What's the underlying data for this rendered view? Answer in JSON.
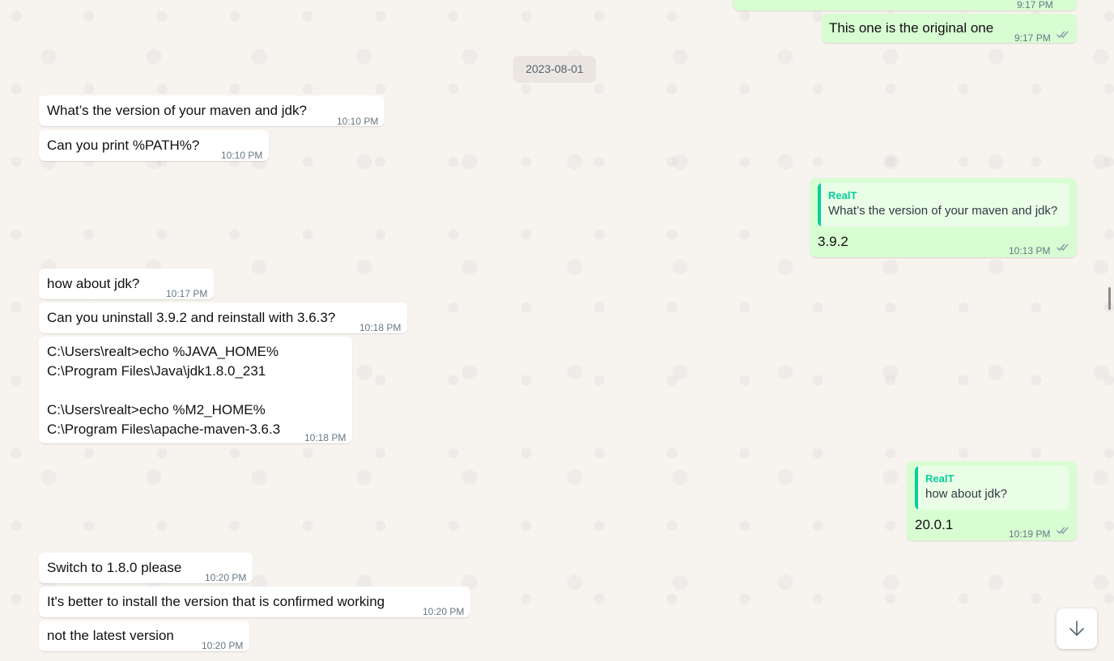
{
  "prev_message": {
    "time": "9:17 PM"
  },
  "messages_top": [
    {
      "text": "This one is the original one",
      "time": "9:17 PM"
    }
  ],
  "date_separator": "2023-08-01",
  "incoming_1": [
    {
      "text": "What’s the version of your maven and jdk?",
      "time": "10:10 PM"
    },
    {
      "text": "Can you print %PATH%?",
      "time": "10:10 PM"
    }
  ],
  "reply_1": {
    "quote_author": "RealT",
    "quote_text": "What’s the version of your maven and jdk?",
    "text": "3.9.2",
    "time": "10:13 PM"
  },
  "incoming_2": [
    {
      "text": "how about jdk?",
      "time": "10:17 PM"
    },
    {
      "text": "Can you uninstall 3.9.2 and reinstall with 3.6.3?",
      "time": "10:18 PM"
    },
    {
      "text": "C:\\Users\\realt>echo %JAVA_HOME%\nC:\\Program Files\\Java\\jdk1.8.0_231\n\nC:\\Users\\realt>echo %M2_HOME%\nC:\\Program Files\\apache-maven-3.6.3",
      "time": "10:18 PM"
    }
  ],
  "reply_2": {
    "quote_author": "RealT",
    "quote_text": "how about jdk?",
    "text": "20.0.1",
    "time": "10:19 PM"
  },
  "incoming_3": [
    {
      "text": "Switch to 1.8.0 please",
      "time": "10:20 PM"
    },
    {
      "text": "It's better to install the version that is confirmed working",
      "time": "10:20 PM"
    },
    {
      "text": "not the latest version",
      "time": "10:20 PM"
    }
  ],
  "icons": {
    "read_receipt": "double-check-icon",
    "error": "error-icon",
    "scroll_down": "arrow-down-icon"
  },
  "colors": {
    "outgoing_bubble": "#d9fdd3",
    "incoming_bubble": "#ffffff",
    "read_tick": "#8696a0",
    "quote_accent": "#06cf9c"
  }
}
